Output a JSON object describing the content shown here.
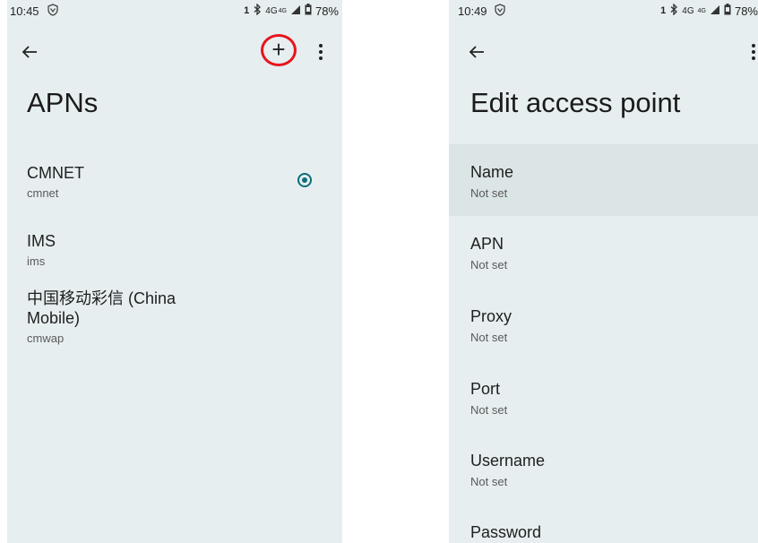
{
  "left_screen": {
    "status": {
      "time": "10:45",
      "sim": "1",
      "network": "4G",
      "network_sup": "4G",
      "battery": "78%"
    },
    "title": "APNs",
    "apns": [
      {
        "name": "CMNET",
        "apn": "cmnet",
        "selected": true
      },
      {
        "name": "IMS",
        "apn": "ims",
        "selected": false
      },
      {
        "name_line1": "中国移动彩信 (China",
        "name_line2": "Mobile)",
        "apn": "cmwap",
        "selected": false
      }
    ],
    "actions": {
      "add_icon": "plus-icon",
      "add_label": "+",
      "menu_icon": "more-vert-icon"
    }
  },
  "right_screen": {
    "status": {
      "time": "10:49",
      "sim": "1",
      "network": "4G",
      "network_sup": "4G",
      "battery": "78%"
    },
    "title": "Edit access point",
    "fields": [
      {
        "title": "Name",
        "summary": "Not set"
      },
      {
        "title": "APN",
        "summary": "Not set"
      },
      {
        "title": "Proxy",
        "summary": "Not set"
      },
      {
        "title": "Port",
        "summary": "Not set"
      },
      {
        "title": "Username",
        "summary": "Not set"
      },
      {
        "title": "Password",
        "summary": ""
      }
    ]
  },
  "colors": {
    "background": "#e6eef0",
    "accent": "#0d6e79",
    "highlight_circle": "#e8141c"
  }
}
